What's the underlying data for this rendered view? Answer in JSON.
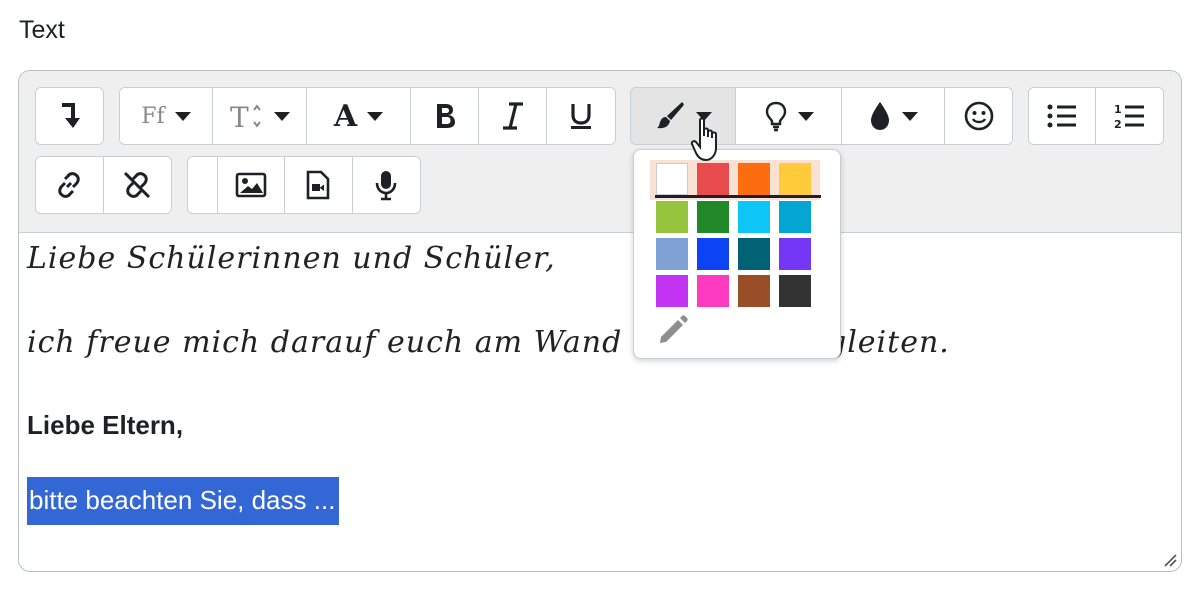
{
  "field": {
    "label": "Text"
  },
  "toolbar": {
    "font_family_label": "Ff",
    "text_color_label": "A"
  },
  "content": {
    "script_line_1": "Liebe Schülerinnen und Schüler,",
    "script_line_2_left": "ich freue mich darauf euch am Wand",
    "script_line_2_right": "gleiten.",
    "bold_line": "Liebe Eltern,",
    "selected_line": "bitte beachten Sie, dass ..."
  },
  "color_palette": {
    "selected_index": 0,
    "colors": [
      "#ffffff",
      "#e84b4b",
      "#fb6d0e",
      "#ffcb3a",
      "#96c43d",
      "#21892a",
      "#0ec6f6",
      "#05a5d1",
      "#80a1d6",
      "#0c43f5",
      "#016175",
      "#7337f5",
      "#c233f2",
      "#fc3bc1",
      "#9a4e27",
      "#333333"
    ]
  }
}
